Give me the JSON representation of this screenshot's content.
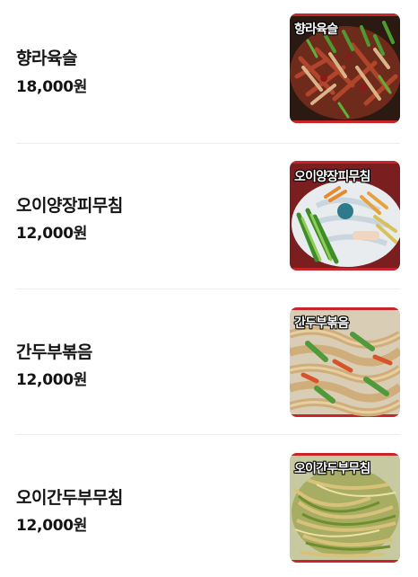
{
  "menu": {
    "items": [
      {
        "name": "향라육슬",
        "price": "18,000원",
        "photo": {
          "caption": "향라육슬",
          "icon": "dish-photo-shredded-pork",
          "accent": "#c8252b"
        }
      },
      {
        "name": "오이양장피무침",
        "price": "12,000원",
        "photo": {
          "caption": "오이양장피무침",
          "icon": "dish-photo-cucumber-noodle-salad",
          "accent": "#c8252b"
        }
      },
      {
        "name": "간두부볶음",
        "price": "12,000원",
        "photo": {
          "caption": "간두부볶음",
          "icon": "dish-photo-stir-fried-tofu-noodles",
          "accent": "#c8252b"
        }
      },
      {
        "name": "오이간두부무침",
        "price": "12,000원",
        "photo": {
          "caption": "오이간두부무침",
          "icon": "dish-photo-cucumber-tofu-salad",
          "accent": "#c8252b"
        }
      }
    ]
  }
}
